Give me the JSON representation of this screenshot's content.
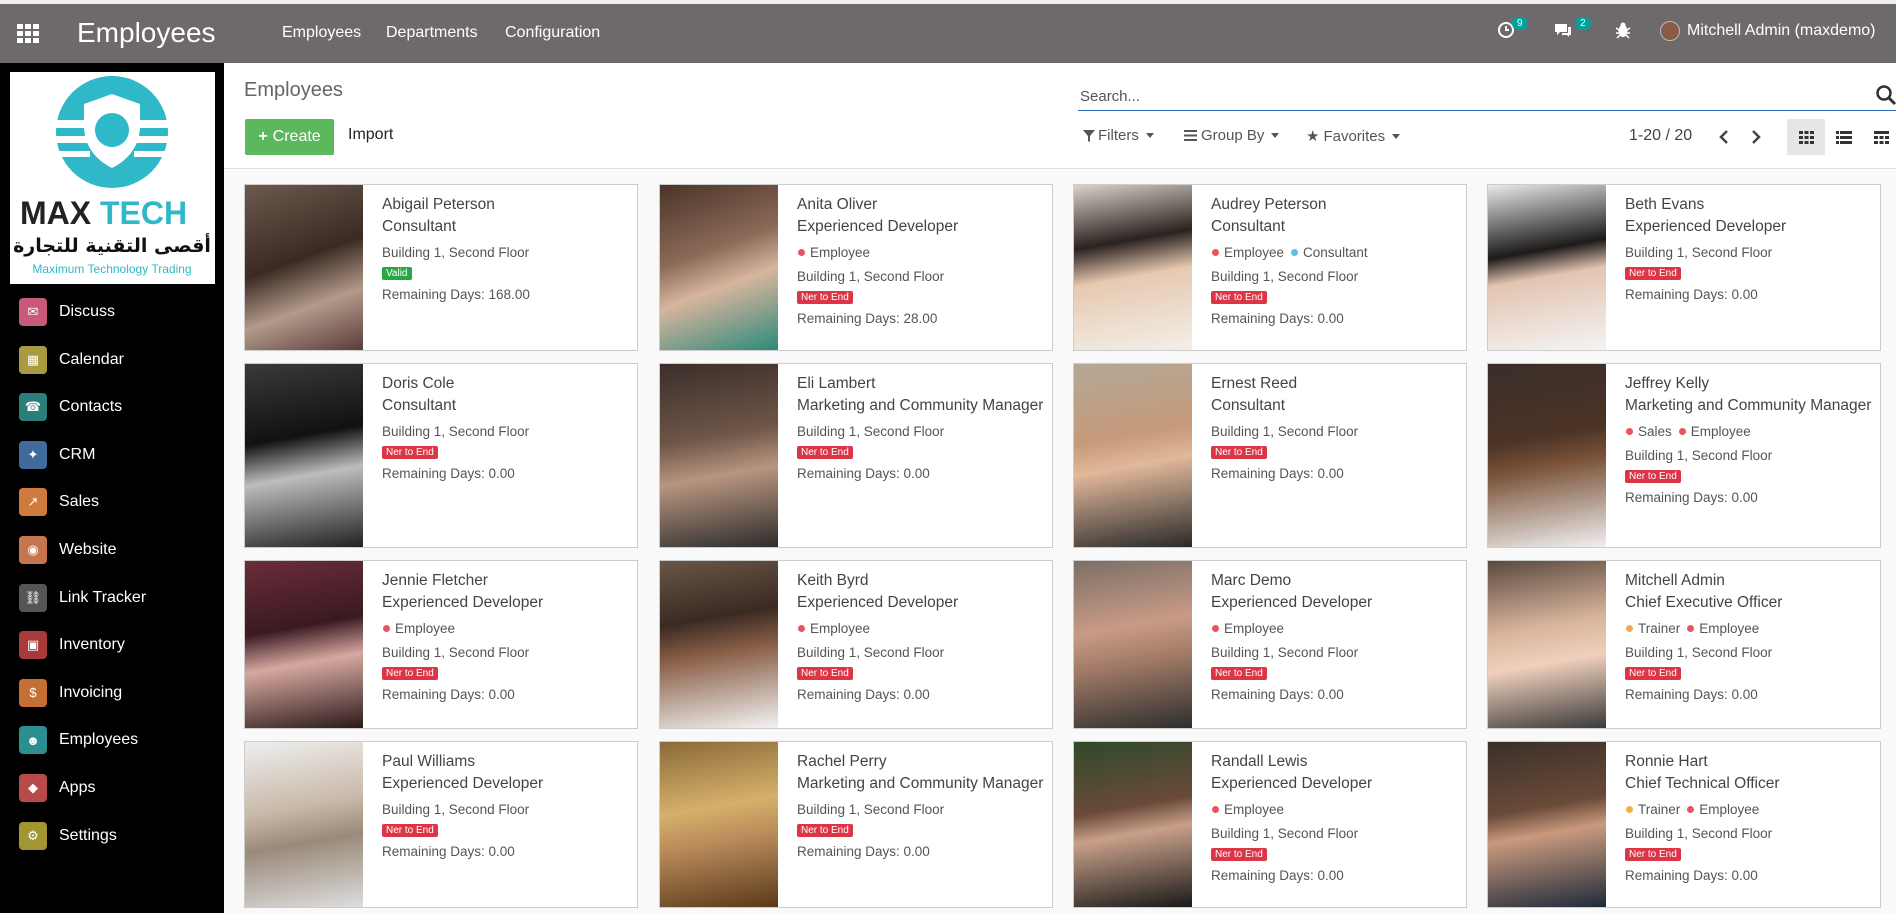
{
  "app": {
    "title": "Employees"
  },
  "topmenu": [
    "Employees",
    "Departments",
    "Configuration"
  ],
  "systray": {
    "activity_count": "9",
    "messages_count": "2",
    "user": "Mitchell Admin (maxdemo)"
  },
  "logo": {
    "brand_a": "MAX",
    "brand_b": "TECH",
    "arabic": "أقصى التقنية للتجارة",
    "tagline": "Maximum Technology Trading"
  },
  "sidebar": [
    {
      "label": "Discuss",
      "icon": "discuss-icon",
      "color": "#c85a79"
    },
    {
      "label": "Calendar",
      "icon": "calendar-icon",
      "color": "#a89a3f"
    },
    {
      "label": "Contacts",
      "icon": "contacts-icon",
      "color": "#2a7f7b"
    },
    {
      "label": "CRM",
      "icon": "crm-icon",
      "color": "#3f6a9c"
    },
    {
      "label": "Sales",
      "icon": "sales-icon",
      "color": "#d07b3e"
    },
    {
      "label": "Website",
      "icon": "website-icon",
      "color": "#c6764e"
    },
    {
      "label": "Link Tracker",
      "icon": "link-icon",
      "color": "#555555"
    },
    {
      "label": "Inventory",
      "icon": "inventory-icon",
      "color": "#a73b3b"
    },
    {
      "label": "Invoicing",
      "icon": "invoicing-icon",
      "color": "#c56f34"
    },
    {
      "label": "Employees",
      "icon": "employees-icon",
      "color": "#2a8f8e"
    },
    {
      "label": "Apps",
      "icon": "apps-icon",
      "color": "#b74b4b"
    },
    {
      "label": "Settings",
      "icon": "settings-icon",
      "color": "#a1962f"
    }
  ],
  "control": {
    "breadcrumb": "Employees",
    "create": "Create",
    "import": "Import",
    "search_placeholder": "Search...",
    "filters": "Filters",
    "groupby": "Group By",
    "favorites": "Favorites",
    "pager": "1-20 / 20"
  },
  "employees": [
    {
      "name": "Abigail Peterson",
      "job": "Consultant",
      "tags": [],
      "location": "Building 1, Second Floor",
      "status": "Valid",
      "status_color": "green",
      "remaining": "Remaining Days: 168.00"
    },
    {
      "name": "Anita Oliver",
      "job": "Experienced Developer",
      "tags": [
        {
          "label": "Employee",
          "color": "#e8545e"
        }
      ],
      "location": "Building 1, Second Floor",
      "status": "Ner to End",
      "status_color": "red",
      "remaining": "Remaining Days: 28.00"
    },
    {
      "name": "Audrey Peterson",
      "job": "Consultant",
      "tags": [
        {
          "label": "Employee",
          "color": "#e8545e"
        },
        {
          "label": "Consultant",
          "color": "#5bc0de"
        }
      ],
      "location": "Building 1, Second Floor",
      "status": "Ner to End",
      "status_color": "red",
      "remaining": "Remaining Days: 0.00"
    },
    {
      "name": "Beth Evans",
      "job": "Experienced Developer",
      "tags": [],
      "location": "Building 1, Second Floor",
      "status": "Ner to End",
      "status_color": "red",
      "remaining": "Remaining Days: 0.00"
    },
    {
      "name": "Doris Cole",
      "job": "Consultant",
      "tags": [],
      "location": "Building 1, Second Floor",
      "status": "Ner to End",
      "status_color": "red",
      "remaining": "Remaining Days: 0.00"
    },
    {
      "name": "Eli Lambert",
      "job": "Marketing and Community Manager",
      "tags": [],
      "location": "Building 1, Second Floor",
      "status": "Ner to End",
      "status_color": "red",
      "remaining": "Remaining Days: 0.00"
    },
    {
      "name": "Ernest Reed",
      "job": "Consultant",
      "tags": [],
      "location": "Building 1, Second Floor",
      "status": "Ner to End",
      "status_color": "red",
      "remaining": "Remaining Days: 0.00"
    },
    {
      "name": "Jeffrey Kelly",
      "job": "Marketing and Community Manager",
      "tags": [
        {
          "label": "Sales",
          "color": "#e8545e"
        },
        {
          "label": "Employee",
          "color": "#e8545e"
        }
      ],
      "location": "Building 1, Second Floor",
      "status": "Ner to End",
      "status_color": "red",
      "remaining": "Remaining Days: 0.00"
    },
    {
      "name": "Jennie Fletcher",
      "job": "Experienced Developer",
      "tags": [
        {
          "label": "Employee",
          "color": "#e8545e"
        }
      ],
      "location": "Building 1, Second Floor",
      "status": "Ner to End",
      "status_color": "red",
      "remaining": "Remaining Days: 0.00"
    },
    {
      "name": "Keith Byrd",
      "job": "Experienced Developer",
      "tags": [
        {
          "label": "Employee",
          "color": "#e8545e"
        }
      ],
      "location": "Building 1, Second Floor",
      "status": "Ner to End",
      "status_color": "red",
      "remaining": "Remaining Days: 0.00"
    },
    {
      "name": "Marc Demo",
      "job": "Experienced Developer",
      "tags": [
        {
          "label": "Employee",
          "color": "#e8545e"
        }
      ],
      "location": "Building 1, Second Floor",
      "status": "Ner to End",
      "status_color": "red",
      "remaining": "Remaining Days: 0.00"
    },
    {
      "name": "Mitchell Admin",
      "job": "Chief Executive Officer",
      "tags": [
        {
          "label": "Trainer",
          "color": "#f0ad4e"
        },
        {
          "label": "Employee",
          "color": "#e8545e"
        }
      ],
      "location": "Building 1, Second Floor",
      "status": "Ner to End",
      "status_color": "red",
      "remaining": "Remaining Days: 0.00"
    },
    {
      "name": "Paul Williams",
      "job": "Experienced Developer",
      "tags": [],
      "location": "Building 1, Second Floor",
      "status": "Ner to End",
      "status_color": "red",
      "remaining": "Remaining Days: 0.00"
    },
    {
      "name": "Rachel Perry",
      "job": "Marketing and Community Manager",
      "tags": [],
      "location": "Building 1, Second Floor",
      "status": "Ner to End",
      "status_color": "red",
      "remaining": "Remaining Days: 0.00"
    },
    {
      "name": "Randall Lewis",
      "job": "Experienced Developer",
      "tags": [
        {
          "label": "Employee",
          "color": "#e8545e"
        }
      ],
      "location": "Building 1, Second Floor",
      "status": "Ner to End",
      "status_color": "red",
      "remaining": "Remaining Days: 0.00"
    },
    {
      "name": "Ronnie Hart",
      "job": "Chief Technical Officer",
      "tags": [
        {
          "label": "Trainer",
          "color": "#f0ad4e"
        },
        {
          "label": "Employee",
          "color": "#e8545e"
        }
      ],
      "location": "Building 1, Second Floor",
      "status": "Ner to End",
      "status_color": "red",
      "remaining": "Remaining Days: 0.00"
    }
  ]
}
